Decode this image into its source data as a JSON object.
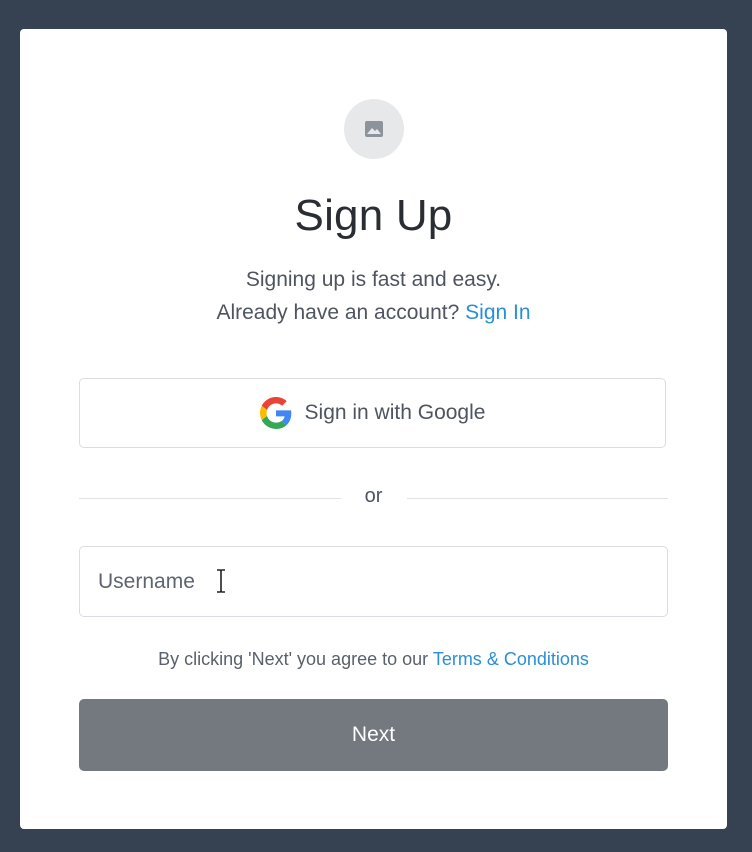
{
  "header": {
    "logo_icon": "image-placeholder-icon",
    "title": "Sign Up",
    "subtitle": "Signing up is fast and easy.",
    "signin_prompt": "Already have an account?",
    "signin_link": "Sign In"
  },
  "google": {
    "icon": "google-icon",
    "label": "Sign in with Google"
  },
  "divider": {
    "label": "or"
  },
  "form": {
    "username_placeholder": "Username",
    "username_value": ""
  },
  "terms": {
    "prefix": "By clicking 'Next' you agree to our",
    "link": "Terms & Conditions"
  },
  "actions": {
    "next_label": "Next"
  },
  "colors": {
    "background": "#364151",
    "card": "#ffffff",
    "link": "#2a8fd6",
    "next_button": "#747980"
  }
}
